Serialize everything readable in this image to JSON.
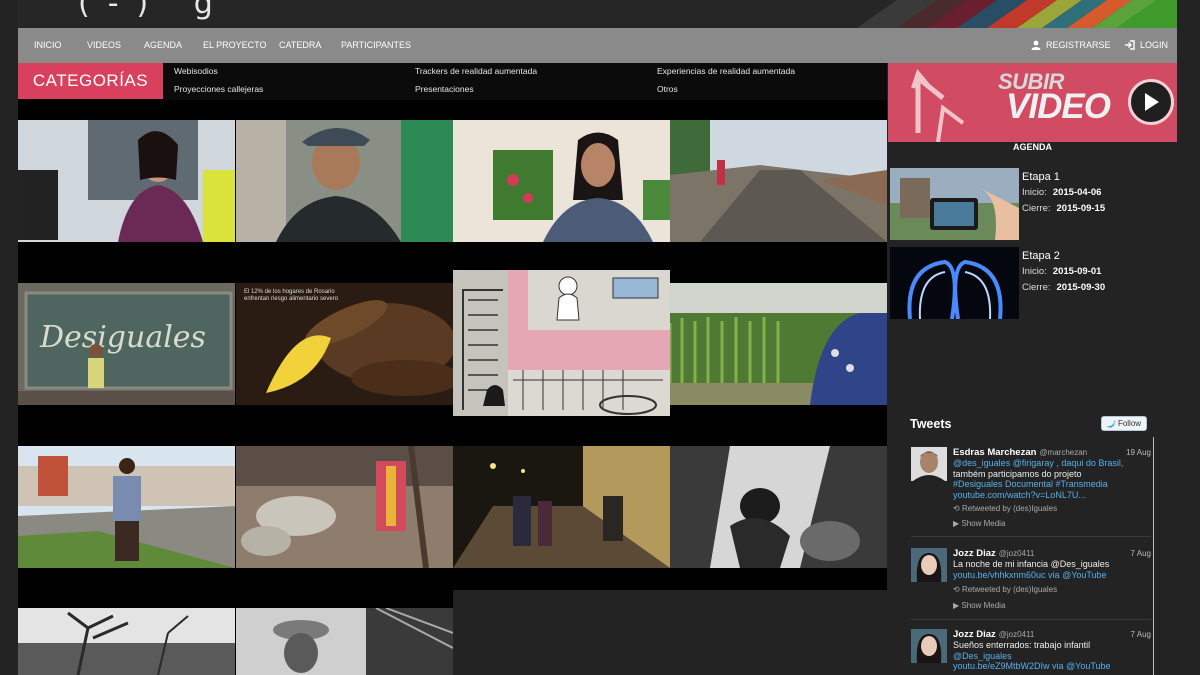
{
  "logo": "(-) g",
  "nav": {
    "items": [
      "INICIO",
      "VIDEOS",
      "AGENDA",
      "EL PROYECTO",
      "CATEDRA",
      "PARTICIPANTES"
    ],
    "register": "REGISTRARSE",
    "login": "LOGIN"
  },
  "categories": {
    "title": "CATEGORÍAS",
    "links": [
      "Webisodios",
      "Trackers de realidad aumentada",
      "Experiencias de realidad aumentada",
      "Proyecciones callejeras",
      "Presentaciones",
      "Otros"
    ]
  },
  "thumbnail_overlay_text": "El 12% de los hogares de Rosario enfrentan riesgo alimentario severo",
  "upload": {
    "line1": "SUBIR",
    "line2": "VIDEO"
  },
  "agenda": {
    "label": "AGENDA",
    "start_label": "Inicio:",
    "end_label": "Cierre:",
    "stages": [
      {
        "name": "Etapa 1",
        "start": "2015-04-06",
        "end": "2015-09-15"
      },
      {
        "name": "Etapa 2",
        "start": "2015-09-01",
        "end": "2015-09-30"
      }
    ]
  },
  "tweets": {
    "title": "Tweets",
    "follow": "Follow",
    "show_media": "Show Media",
    "items": [
      {
        "name": "Esdras Marchezan",
        "handle": "@marchezan",
        "date": "19 Aug",
        "lines": [
          "@des_iguales @firigaray , daqui do Brasil,",
          "também participamos do projeto",
          "#Desiguales Documental #Transmedia",
          "youtube.com/watch?v=LoNL7U..."
        ],
        "retweet": "Retweeted by (des)Iguales"
      },
      {
        "name": "Jozz Diaz",
        "handle": "@joz0411",
        "date": "7 Aug",
        "lines": [
          "La noche de mi infancia @Des_iguales",
          "youtu.be/vhhkxnm60uc via @YouTube"
        ],
        "retweet": "Retweeted by (des)Iguales"
      },
      {
        "name": "Jozz Diaz",
        "handle": "@joz0411",
        "date": "7 Aug",
        "lines": [
          "Sueños enterrados: trabajo infantil",
          "@Des_iguales",
          "youtu.be/eZ9MtbW2DIw via @YouTube"
        ]
      }
    ]
  },
  "colors": {
    "accent": "#d8405e",
    "nav_bg": "#8a8a8a",
    "link": "#56b0ee",
    "page_bg": "#232323"
  }
}
